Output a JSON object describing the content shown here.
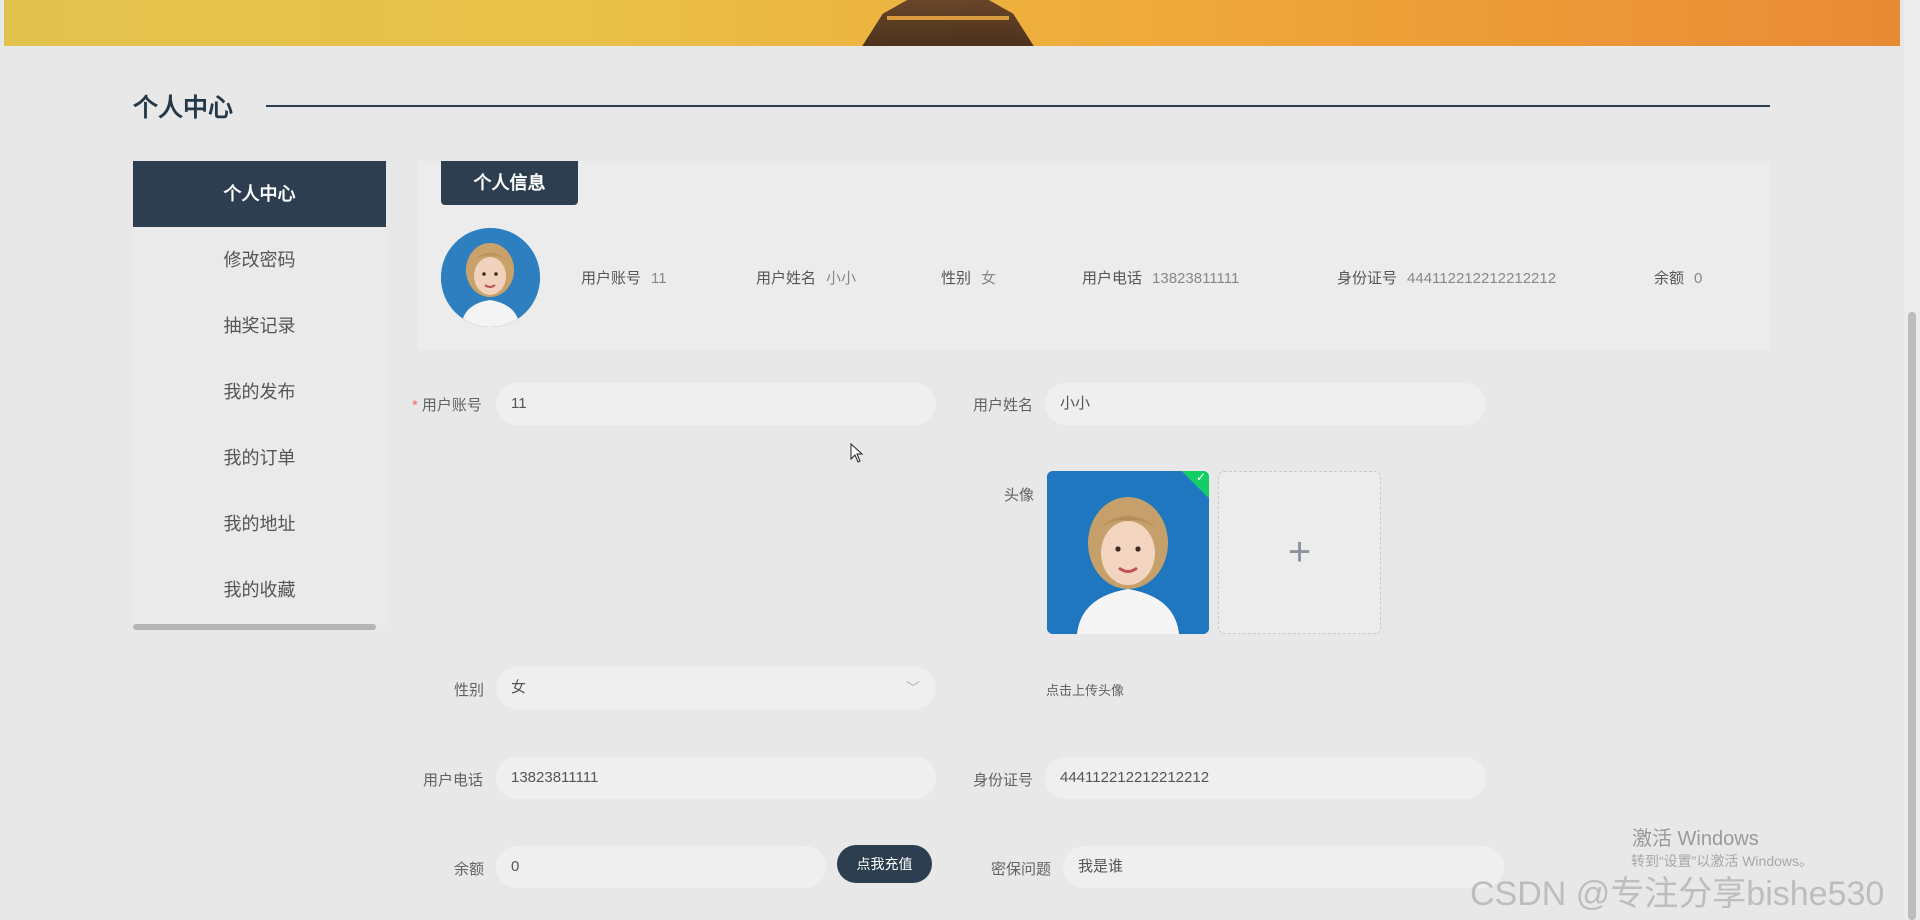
{
  "page": {
    "title": "个人中心"
  },
  "sidebar": {
    "items": [
      {
        "label": "个人中心",
        "active": true
      },
      {
        "label": "修改密码"
      },
      {
        "label": "抽奖记录"
      },
      {
        "label": "我的发布"
      },
      {
        "label": "我的订单"
      },
      {
        "label": "我的地址"
      },
      {
        "label": "我的收藏"
      }
    ]
  },
  "info_card": {
    "tab_label": "个人信息",
    "fields": [
      {
        "key": "用户账号",
        "value": "11"
      },
      {
        "key": "用户姓名",
        "value": "小小"
      },
      {
        "key": "性别",
        "value": "女"
      },
      {
        "key": "用户电话",
        "value": "13823811111"
      },
      {
        "key": "身份证号",
        "value": "444112212212212212"
      },
      {
        "key": "余额",
        "value": "0"
      }
    ]
  },
  "form": {
    "account": {
      "label": "用户账号",
      "value": "11",
      "required_mark": "*"
    },
    "name": {
      "label": "用户姓名",
      "value": "小小"
    },
    "avatar": {
      "label": "头像",
      "tip": "点击上传头像"
    },
    "gender": {
      "label": "性别",
      "value": "女"
    },
    "phone": {
      "label": "用户电话",
      "value": "13823811111"
    },
    "id_card": {
      "label": "身份证号",
      "value": "444112212212212212"
    },
    "balance": {
      "label": "余额",
      "value": "0",
      "charge_button": "点我充值"
    },
    "security_question": {
      "label": "密保问题",
      "value": "我是谁"
    }
  },
  "watermarks": {
    "activate_title": "激活 Windows",
    "activate_sub": "转到“设置”以激活 Windows。",
    "csdn": "CSDN @专注分享bishe530"
  },
  "icons": {
    "upload": "plus-icon",
    "dropdown": "chevron-down-icon",
    "success": "check-icon"
  },
  "colors": {
    "primary": "#2c3e50",
    "success": "#13ce66",
    "required": "#f56c6c"
  }
}
